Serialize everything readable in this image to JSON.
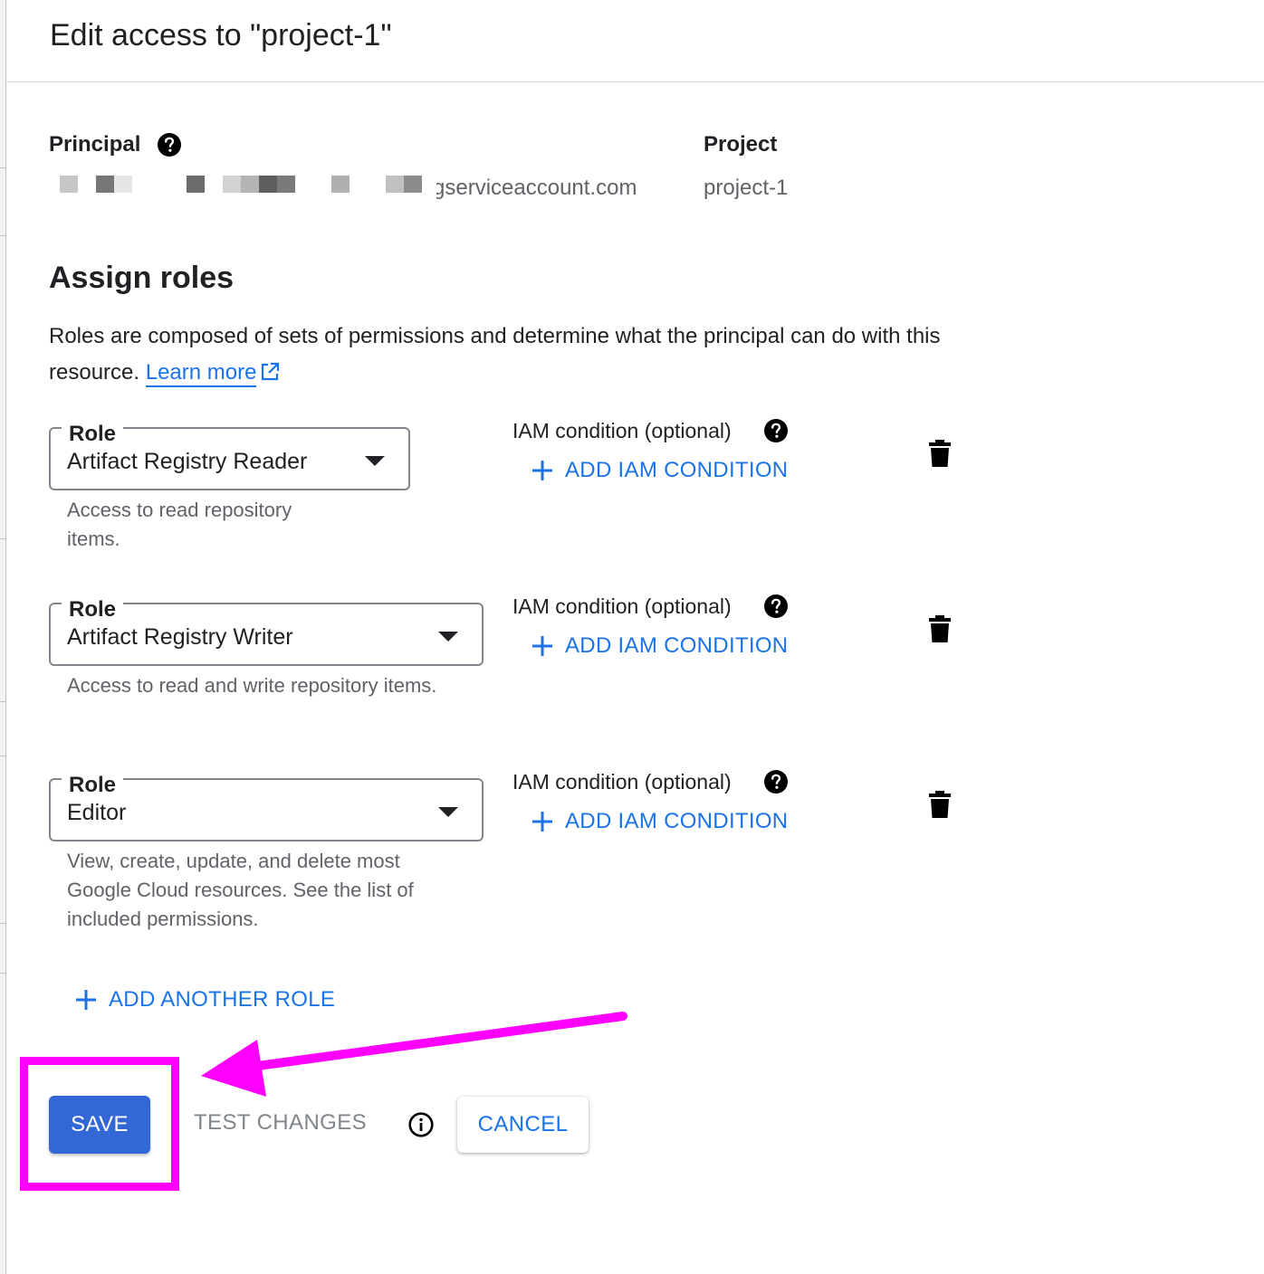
{
  "header": {
    "title": "Edit access to \"project-1\""
  },
  "principal": {
    "label": "Principal",
    "value_visible_suffix": "gserviceaccount.com"
  },
  "project": {
    "label": "Project",
    "value": "project-1"
  },
  "assign_roles": {
    "title": "Assign roles",
    "description": "Roles are composed of sets of permissions and determine what the principal can do with this resource.",
    "learn_more": "Learn more"
  },
  "roles": [
    {
      "field_label": "Role",
      "value": "Artifact Registry Reader",
      "help": "Access to read repository items.",
      "iam_label": "IAM condition (optional)",
      "add_condition": "ADD IAM CONDITION"
    },
    {
      "field_label": "Role",
      "value": "Artifact Registry Writer",
      "help": "Access to read and write repository items.",
      "iam_label": "IAM condition (optional)",
      "add_condition": "ADD IAM CONDITION"
    },
    {
      "field_label": "Role",
      "value": "Editor",
      "help": "View, create, update, and delete most Google Cloud resources. See the list of included permissions.",
      "iam_label": "IAM condition (optional)",
      "add_condition": "ADD IAM CONDITION"
    }
  ],
  "add_another_role": "ADD ANOTHER ROLE",
  "actions": {
    "save": "SAVE",
    "test_changes": "TEST CHANGES",
    "cancel": "CANCEL"
  },
  "icons": {
    "help": "help-circle-icon",
    "external_link": "external-link-icon",
    "dropdown": "dropdown-arrow-icon",
    "add": "plus-icon",
    "delete": "trash-icon",
    "info": "info-icon"
  },
  "colors": {
    "accent": "#1a73e8",
    "save_button": "#3367d6",
    "annotation": "#ff00ff",
    "muted_text": "#5f6368",
    "disabled_text": "#80868b"
  }
}
